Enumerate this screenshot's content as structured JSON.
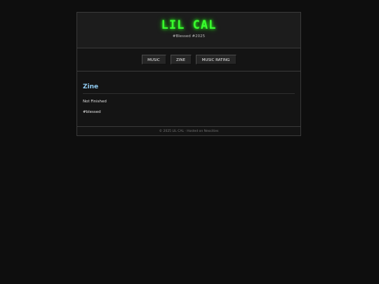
{
  "header": {
    "title": "LIL CAL",
    "tagline": "#Blessed #2025"
  },
  "nav": {
    "items": [
      {
        "label": "MUSIC"
      },
      {
        "label": "ZINE"
      },
      {
        "label": "MUSIC RATING"
      }
    ]
  },
  "main": {
    "title": "Zine",
    "paragraphs": [
      "Not Finished",
      "#blessed"
    ]
  },
  "footer": {
    "text": "© 2025 LIL CAL · Hosted on Neocities"
  },
  "colors": {
    "background": "#0e0e0e",
    "title_glow": "#39ff2e",
    "heading": "#8fcaf0"
  }
}
